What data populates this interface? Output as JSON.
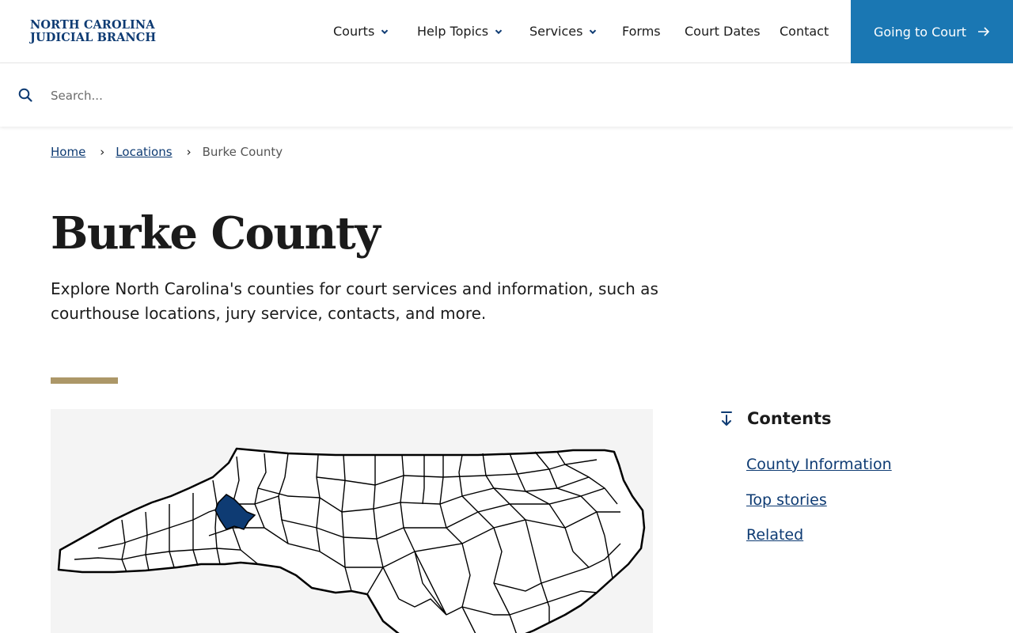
{
  "logo": {
    "line1": "NORTH CAROLINA",
    "line2": "JUDICIAL BRANCH"
  },
  "nav": {
    "items": [
      {
        "label": "Courts",
        "dropdown": true
      },
      {
        "label": "Help Topics",
        "dropdown": true
      },
      {
        "label": "Services",
        "dropdown": true
      },
      {
        "label": "Forms",
        "dropdown": false
      },
      {
        "label": "Court Dates",
        "dropdown": false
      },
      {
        "label": "Contact",
        "dropdown": false
      }
    ],
    "cta_label": "Going to Court"
  },
  "search": {
    "placeholder": "Search...",
    "value": ""
  },
  "breadcrumb": {
    "home": "Home",
    "locations": "Locations",
    "current": "Burke County"
  },
  "page": {
    "title": "Burke County",
    "intro": "Explore North Carolina's counties for court services and information, such as courthouse locations, jury service, contacts, and more."
  },
  "map": {
    "highlighted_county": "Burke County",
    "highlight_color": "#0e3b73"
  },
  "contents": {
    "title": "Contents",
    "links": [
      "County Information",
      "Top stories",
      "Related"
    ]
  },
  "colors": {
    "brand": "#0e3b73",
    "cta": "#1a77b3",
    "accent": "#ac9768",
    "link": "#0e3b73"
  },
  "icons": [
    "search-icon",
    "chevron-down-icon",
    "arrow-right-icon",
    "arrow-down-to-line-icon"
  ]
}
